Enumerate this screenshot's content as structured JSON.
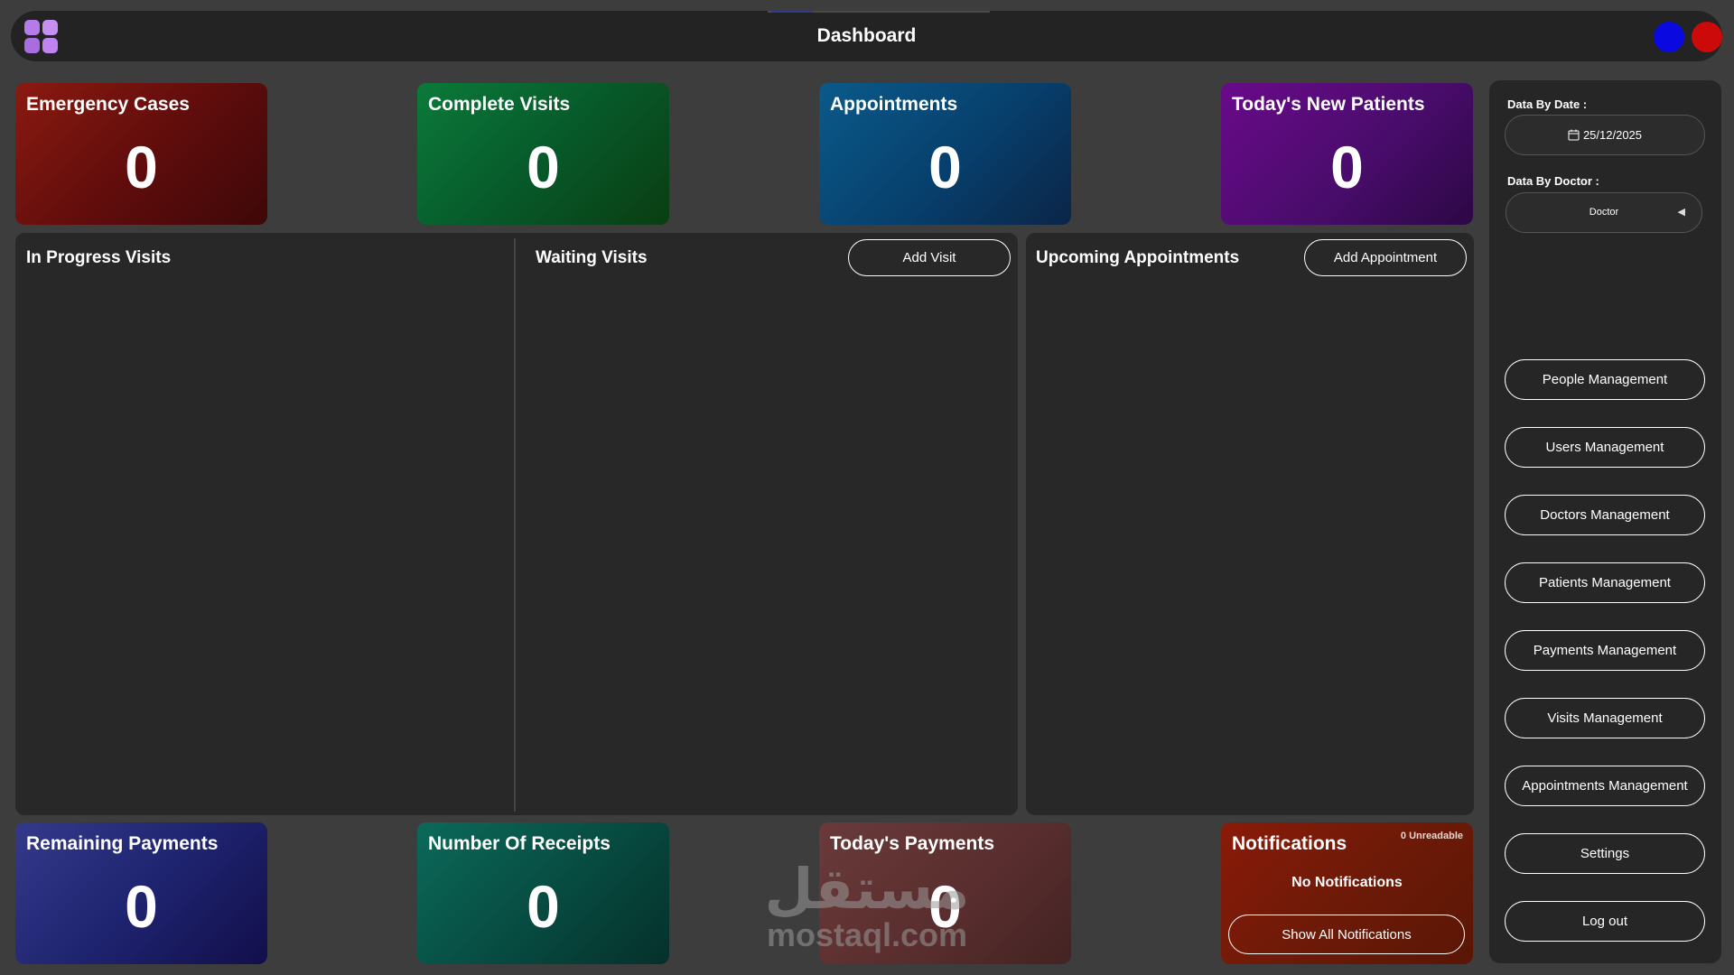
{
  "header": {
    "title": "Dashboard",
    "logo_icon": "grid-logo-icon",
    "colors": {
      "minimize": "#0a0ae0",
      "close": "#cc0a0a"
    }
  },
  "stats_top": {
    "emergency": {
      "label": "Emergency Cases",
      "value": "0"
    },
    "complete": {
      "label": "Complete Visits",
      "value": "0"
    },
    "appointments": {
      "label": "Appointments",
      "value": "0"
    },
    "new_patients": {
      "label": "Today's New Patients",
      "value": "0"
    }
  },
  "panels": {
    "in_progress": {
      "title": "In Progress Visits"
    },
    "waiting": {
      "title": "Waiting Visits",
      "add_label": "Add Visit"
    },
    "upcoming": {
      "title": "Upcoming Appointments",
      "add_label": "Add Appointment"
    }
  },
  "stats_bottom": {
    "remaining": {
      "label": "Remaining Payments",
      "value": "0"
    },
    "receipts": {
      "label": "Number Of Receipts",
      "value": "0"
    },
    "today_payments": {
      "label": "Today's Payments",
      "value": "0"
    },
    "notifications": {
      "label": "Notifications",
      "unread": "0 Unreadable",
      "empty_text": "No Notifications",
      "show_all_label": "Show All Notifications"
    }
  },
  "sidebar": {
    "date_label": "Data By Date :",
    "date_value": "25/12/2025",
    "doctor_label": "Data By Doctor :",
    "doctor_value": "Doctor",
    "nav": [
      {
        "label": "People Management"
      },
      {
        "label": "Users Management"
      },
      {
        "label": "Doctors Management"
      },
      {
        "label": "Patients Management"
      },
      {
        "label": "Payments Management"
      },
      {
        "label": "Visits Management"
      },
      {
        "label": "Appointments Management"
      },
      {
        "label": "Settings"
      },
      {
        "label": "Log out"
      }
    ]
  },
  "watermark": {
    "arabic": "مستقل",
    "latin": "mostaql.com"
  }
}
